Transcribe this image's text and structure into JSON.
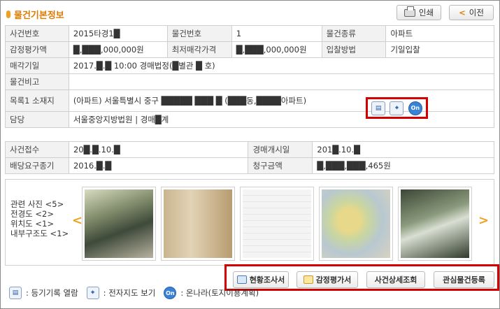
{
  "header": {
    "title": "물건기본정보",
    "print_label": "인쇄",
    "prev_label": "이전",
    "prev_chevron": "<"
  },
  "basic": {
    "case_no_label": "사건번호",
    "case_no": "2015타경1█",
    "item_no_label": "물건번호",
    "item_no": "1",
    "item_type_label": "물건종류",
    "item_type": "아파트",
    "appraisal_label": "감정평가액",
    "appraisal": "█,███,000,000원",
    "min_price_label": "최저매각가격",
    "min_price": "█,███,000,000원",
    "bid_method_label": "입찰방법",
    "bid_method": "기일입찰",
    "sale_date_label": "매각기일",
    "sale_date": "2017.█.█ 10:00 경매법정(█별관 █ 호)",
    "note_label": "물건비고",
    "note": "",
    "location_label": "목록1 소재지",
    "location": "(아파트) 서울특별시 중구 █████ ███ █ (███동,████아파트)",
    "manager_label": "담당",
    "manager": "서울중앙지방법원 | 경매█계"
  },
  "case": {
    "received_label": "사건접수",
    "received": "20█.█.10.█",
    "start_label": "경매개시일",
    "start": "201█.10.█",
    "deadline_label": "배당요구종기",
    "deadline": "2016.█.█",
    "claim_label": "청구금액",
    "claim": "█,███,███,465원"
  },
  "photos": {
    "labels": [
      "관련 사진 <5>",
      "전경도 <2>",
      "위치도 <1>",
      "내부구조도 <1>"
    ],
    "prev_arrow": "<",
    "next_arrow": ">",
    "count": 5
  },
  "actions": {
    "status_report": "현황조사서",
    "appraisal_report": "감정평가서",
    "case_detail": "사건상세조회",
    "watchlist": "관심물건등록"
  },
  "legend": {
    "registry": ": 등기기록 열람",
    "map": ": 전자지도 보기",
    "onnara": ": 온나라(토지이용계획)"
  },
  "icons": {
    "onnara_glyph": "On",
    "registry_glyph": "▤",
    "map_glyph": "⌖"
  },
  "colors": {
    "accent": "#e07a00",
    "highlight_border": "#d40000"
  }
}
